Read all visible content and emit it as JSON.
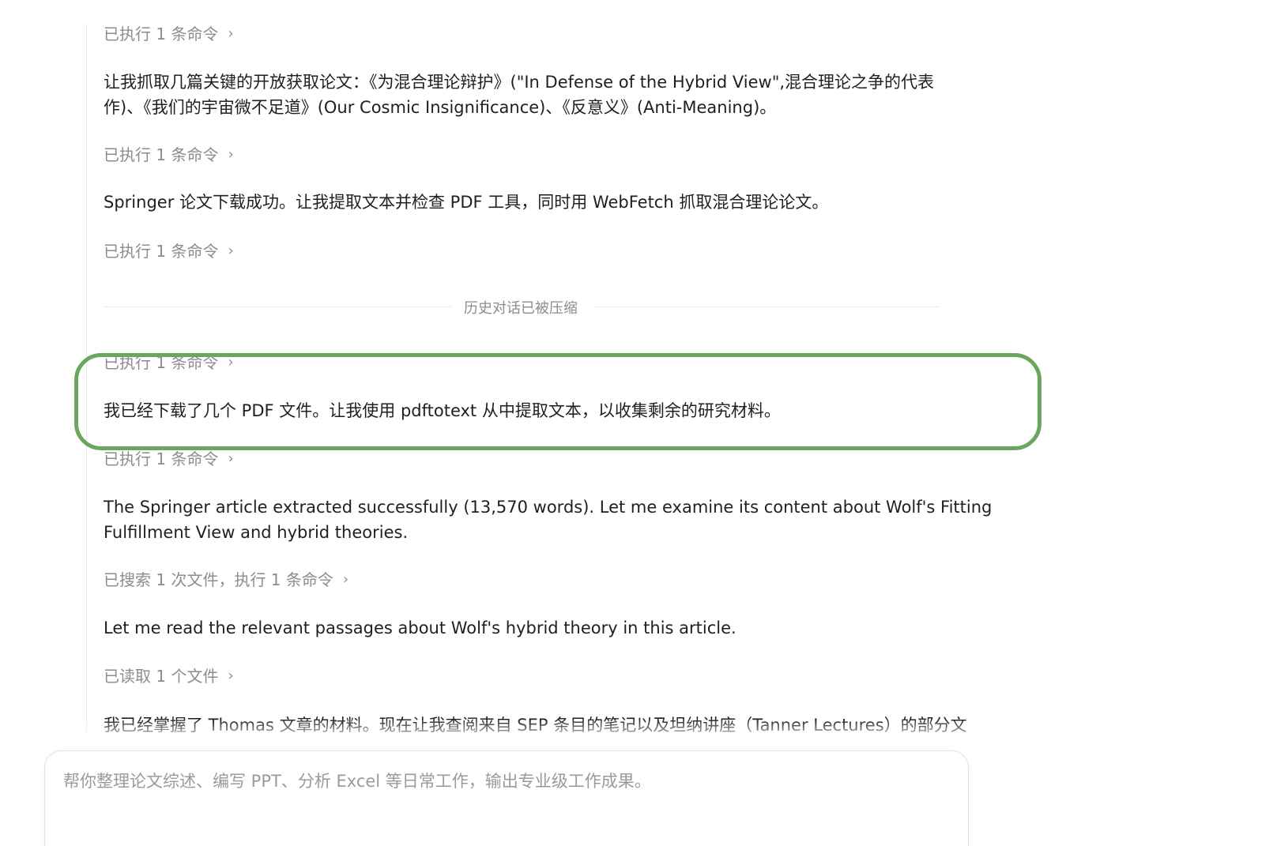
{
  "timeline": [
    {
      "kind": "step",
      "text": "已执行 1 条命令"
    },
    {
      "kind": "msg",
      "text": "让我抓取几篇关键的开放获取论文：《为混合理论辩护》(\"In Defense of the Hybrid View\",混合理论之争的代表"
    },
    {
      "kind": "msg",
      "text": "作)、《我们的宇宙微不足道》(Our Cosmic Insignificance)、《反意义》(Anti-Meaning)。"
    },
    {
      "kind": "step",
      "text": "已执行 1 条命令"
    },
    {
      "kind": "msg",
      "text": "Springer 论文下载成功。让我提取文本并检查 PDF 工具，同时用 WebFetch 抓取混合理论论文。"
    },
    {
      "kind": "step",
      "text": "已执行 1 条命令"
    },
    {
      "kind": "divider",
      "text": "历史对话已被压缩"
    },
    {
      "kind": "step",
      "text": "已执行 1 条命令"
    },
    {
      "kind": "msg",
      "text": "我已经下载了几个 PDF 文件。让我使用 pdftotext 从中提取文本，以收集剩余的研究材料。"
    },
    {
      "kind": "step",
      "text": "已执行 1 条命令"
    },
    {
      "kind": "msg",
      "text": "The Springer article extracted successfully (13,570 words). Let me examine its content about Wolf's Fitting"
    },
    {
      "kind": "msg",
      "text": "Fulfillment View and hybrid theories."
    },
    {
      "kind": "step",
      "text": "已搜索 1 次文件，执行 1 条命令"
    },
    {
      "kind": "msg",
      "text": "Let me read the relevant passages about Wolf's hybrid theory in this article."
    },
    {
      "kind": "step",
      "text": "已读取 1 个文件"
    },
    {
      "kind": "msg",
      "text": "我已经掌握了 Thomas 文章的材料。现在让我查阅来自 SEP 条目的笔记以及坦纳讲座（Tanner Lectures）的部分文"
    }
  ],
  "step_chevron": "›",
  "composer": {
    "placeholder": "帮你整理论文综述、编写 PPT、分析 Excel 等日常工作，输出专业级工作成果。"
  },
  "highlight_color": "#6aa65f"
}
